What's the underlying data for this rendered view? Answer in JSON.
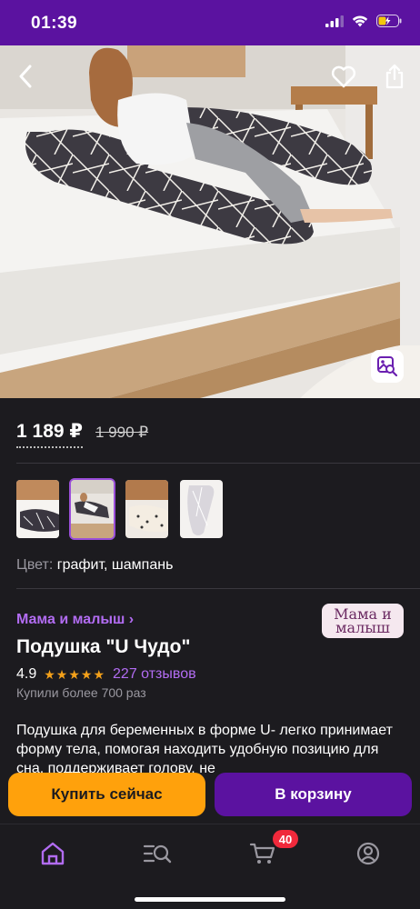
{
  "status": {
    "time": "01:39"
  },
  "product": {
    "price_current": "1 189 ₽",
    "price_old": "1 990 ₽",
    "color_label": "Цвет:",
    "color_value": "графит, шампань",
    "brand_link": "Мама и малыш ›",
    "brand_logo_line1": "Мама и",
    "brand_logo_line2": "малыш",
    "title": "Подушка \"U Чудо\"",
    "rating": "4.9",
    "stars": "★★★★★",
    "reviews": "227 отзывов",
    "purchased": "Купили более 700 раз",
    "description": "Подушка для беременных в форме U- легко принимает форму тела, помогая находить удобную позицию для сна, поддерживает голову, не"
  },
  "thumbnails": [
    {
      "name": "thumb-1",
      "selected": false
    },
    {
      "name": "thumb-2",
      "selected": true
    },
    {
      "name": "thumb-3",
      "selected": false
    },
    {
      "name": "thumb-4",
      "selected": false
    }
  ],
  "actions": {
    "buy_now": "Купить сейчас",
    "add_to_cart": "В корзину"
  },
  "tab_bar": {
    "cart_badge": "40",
    "items": [
      "home-icon",
      "catalog-search-icon",
      "cart-icon",
      "profile-icon"
    ]
  },
  "colors": {
    "brand_purple": "#5b12a0",
    "link_purple": "#b26cf2",
    "buy_orange": "#ffa10c",
    "star_orange": "#f4a11a",
    "badge_red": "#f0293b",
    "background": "#1c1b1f"
  }
}
